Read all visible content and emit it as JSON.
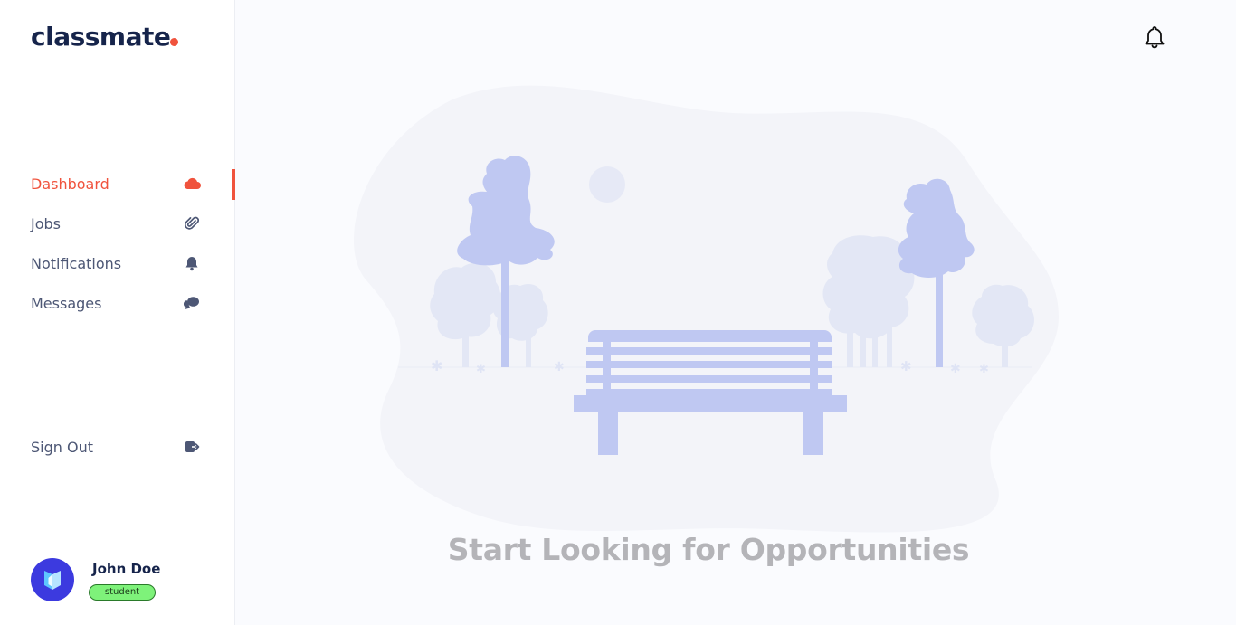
{
  "brand": {
    "name": "classmate",
    "accent": "#f0533d",
    "text_color": "#16244b"
  },
  "nav": [
    {
      "label": "Dashboard",
      "icon": "cloud-icon",
      "active": true
    },
    {
      "label": "Jobs",
      "icon": "paperclip-icon",
      "active": false
    },
    {
      "label": "Notifications",
      "icon": "bell-icon",
      "active": false
    },
    {
      "label": "Messages",
      "icon": "chat-icon",
      "active": false
    }
  ],
  "signout": {
    "label": "Sign Out",
    "icon": "sign-out-icon"
  },
  "user": {
    "name": "John Doe",
    "role": "student",
    "role_color": "#7ef27a"
  },
  "header": {
    "icon": "bell-icon"
  },
  "main": {
    "empty_message": "Start Looking for Opportunities",
    "illustration_color": "#bfc8f2"
  }
}
